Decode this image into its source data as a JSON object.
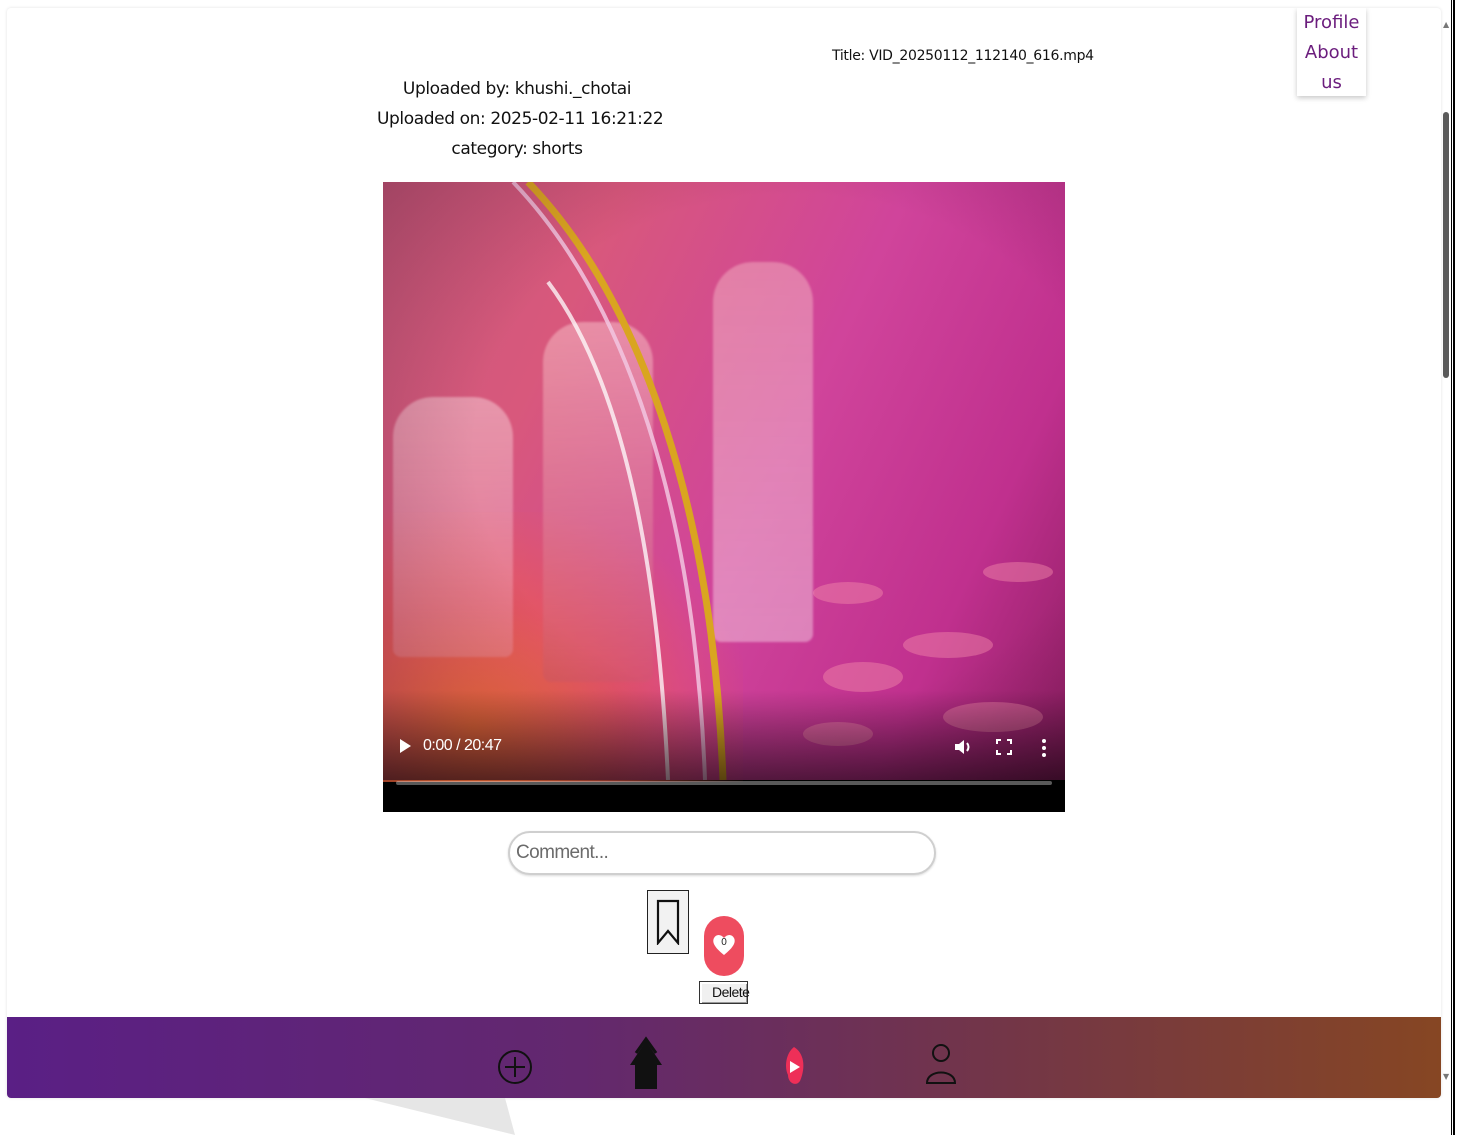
{
  "video": {
    "title_text": "Title: VID_20250112_112140_616.mp4",
    "uploaded_by": "Uploaded by: khushi._chotai",
    "uploaded_on": "Uploaded on: 2025-02-11 16:21:22",
    "category": "category: shorts",
    "player": {
      "time_display": "0:00 / 20:47",
      "progress_fraction": 0,
      "play_icon": "play-icon",
      "volume_icon": "volume-icon",
      "fullscreen_icon": "fullscreen-icon",
      "more_icon": "more-options-icon"
    }
  },
  "menu": {
    "items": [
      {
        "label": "Profile"
      },
      {
        "label": "About"
      },
      {
        "label": "us"
      }
    ]
  },
  "comment": {
    "placeholder": "Comment...",
    "value": ""
  },
  "actions": {
    "bookmark_icon": "bookmark-icon",
    "like_icon": "heart-icon",
    "like_count": "0",
    "delete_label": "Delete"
  },
  "bottom_nav": {
    "items": [
      {
        "icon": "add-circle-icon"
      },
      {
        "icon": "home-icon"
      },
      {
        "icon": "shorts-play-icon",
        "active": true
      },
      {
        "icon": "user-icon"
      }
    ],
    "gradient": [
      "#5a1f85",
      "#864623"
    ],
    "accent": "#ee4c5f"
  }
}
